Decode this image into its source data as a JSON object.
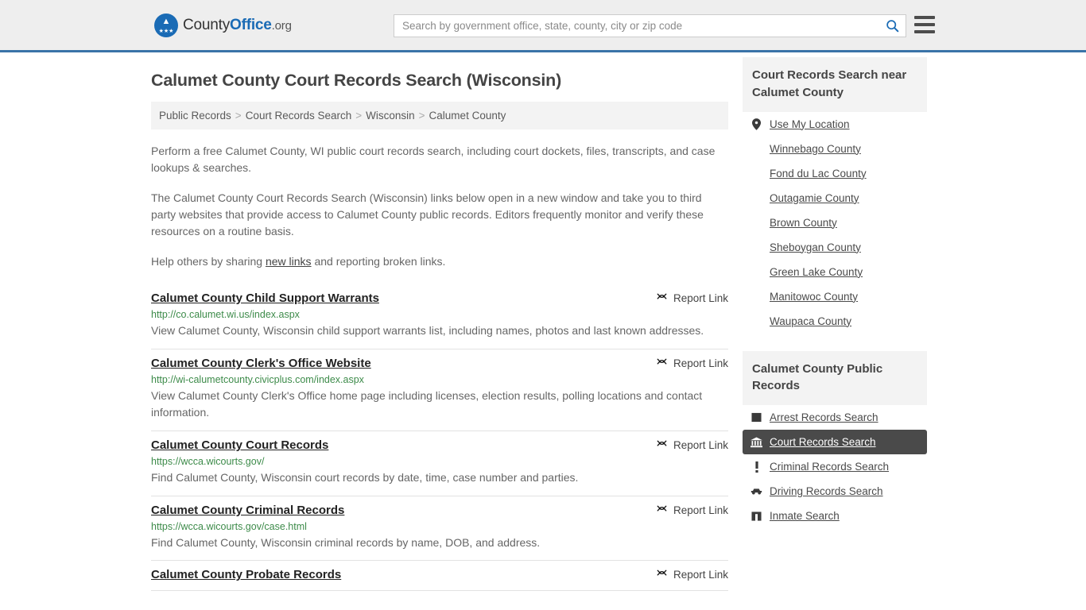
{
  "header": {
    "logo": {
      "name_part1": "County",
      "name_part2": "Office",
      "name_part3": ".org",
      "icon": "eagle-seal-logo"
    },
    "search": {
      "placeholder": "Search by government office, state, county, city or zip code",
      "value": "",
      "search_icon": "search-icon"
    },
    "menu_icon": "hamburger-menu-icon",
    "accent_color": "#3a73a8"
  },
  "page": {
    "title": "Calumet County Court Records Search (Wisconsin)"
  },
  "breadcrumb": {
    "separator": ">",
    "items": [
      "Public Records",
      "Court Records Search",
      "Wisconsin",
      "Calumet County"
    ]
  },
  "intro": {
    "paragraph1": "Perform a free Calumet County, WI public court records search, including court dockets, files, transcripts, and case lookups & searches.",
    "paragraph2": "The Calumet County Court Records Search (Wisconsin) links below open in a new window and take you to third party websites that provide access to Calumet County public records. Editors frequently monitor and verify these resources on a routine basis.",
    "paragraph3_before": "Help others by sharing ",
    "paragraph3_link": "new links",
    "paragraph3_after": " and reporting broken links."
  },
  "results": {
    "report_label": "Report Link",
    "report_icon": "broken-link-icon",
    "items": [
      {
        "title": "Calumet County Child Support Warrants",
        "url": "http://co.calumet.wi.us/index.aspx",
        "description": "View Calumet County, Wisconsin child support warrants list, including names, photos and last known addresses."
      },
      {
        "title": "Calumet County Clerk's Office Website",
        "url": "http://wi-calumetcounty.civicplus.com/index.aspx",
        "description": "View Calumet County Clerk's Office home page including licenses, election results, polling locations and contact information."
      },
      {
        "title": "Calumet County Court Records",
        "url": "https://wcca.wicourts.gov/",
        "description": "Find Calumet County, Wisconsin court records by date, time, case number and parties."
      },
      {
        "title": "Calumet County Criminal Records",
        "url": "https://wcca.wicourts.gov/case.html",
        "description": "Find Calumet County, Wisconsin criminal records by name, DOB, and address."
      },
      {
        "title": "Calumet County Probate Records",
        "url": "",
        "description": ""
      }
    ]
  },
  "sidebar": {
    "nearby": {
      "heading": "Court Records Search near Calumet County",
      "items": [
        {
          "label": "Use My Location",
          "icon": "map-pin-icon"
        },
        {
          "label": "Winnebago County",
          "icon": ""
        },
        {
          "label": "Fond du Lac County",
          "icon": ""
        },
        {
          "label": "Outagamie County",
          "icon": ""
        },
        {
          "label": "Brown County",
          "icon": ""
        },
        {
          "label": "Sheboygan County",
          "icon": ""
        },
        {
          "label": "Green Lake County",
          "icon": ""
        },
        {
          "label": "Manitowoc County",
          "icon": ""
        },
        {
          "label": "Waupaca County",
          "icon": ""
        }
      ]
    },
    "public_records": {
      "heading": "Calumet County Public Records",
      "active_item": "Court Records Search",
      "active_color": "#4a4a4a",
      "items": [
        {
          "label": "Arrest Records Search",
          "icon": "fingerprint-icon",
          "active": false
        },
        {
          "label": "Court Records Search",
          "icon": "courthouse-icon",
          "active": true
        },
        {
          "label": "Criminal Records Search",
          "icon": "exclamation-icon",
          "active": false
        },
        {
          "label": "Driving Records Search",
          "icon": "car-icon",
          "active": false
        },
        {
          "label": "Inmate Search",
          "icon": "jail-building-icon",
          "active": false
        }
      ]
    }
  }
}
